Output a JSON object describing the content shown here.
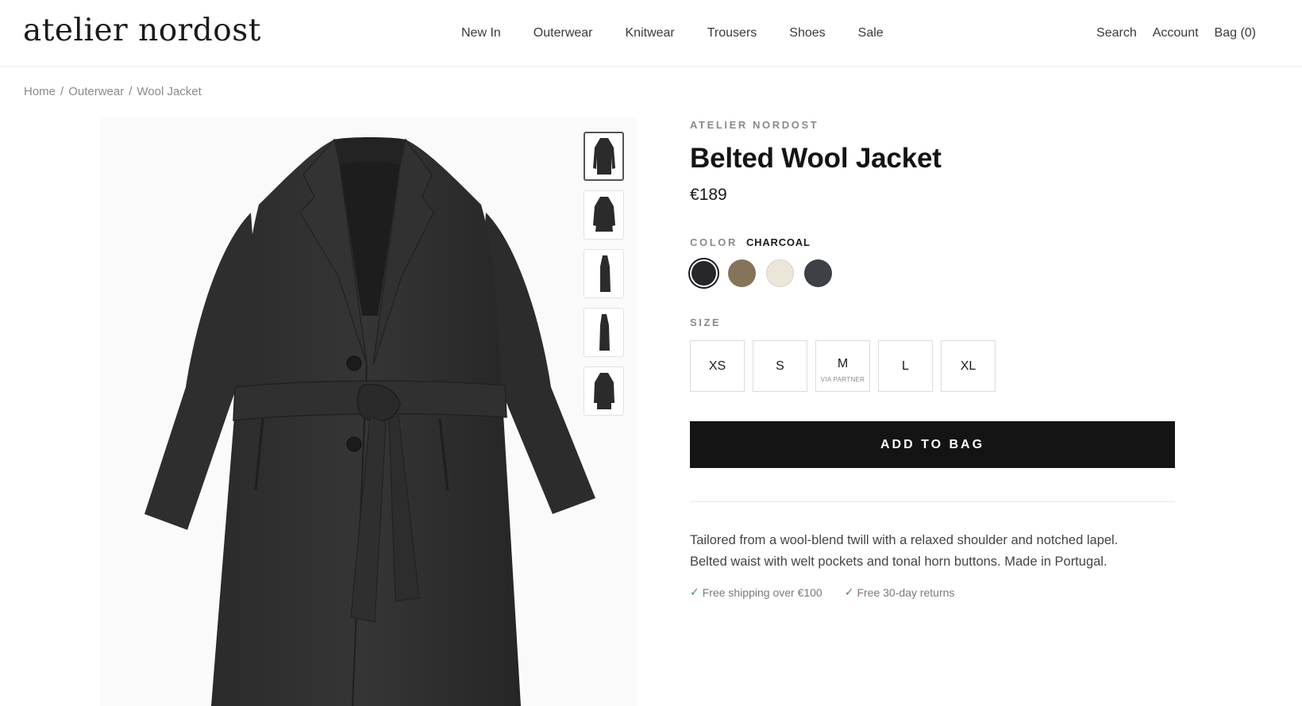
{
  "header": {
    "logo": "atelier nordost",
    "nav": [
      "New In",
      "Outerwear",
      "Knitwear",
      "Trousers",
      "Shoes",
      "Sale"
    ],
    "search": "Search",
    "account": "Account",
    "bag": "Bag (0)"
  },
  "breadcrumb": {
    "home": "Home",
    "separator": "/",
    "category": "Outerwear",
    "current": "Wool Jacket"
  },
  "gallery": {
    "main_image": "charcoal-wool-coat",
    "thumbnails": [
      "front-view",
      "front-belted",
      "side-view",
      "side-back",
      "back-view"
    ],
    "active_thumbnail": 0
  },
  "product": {
    "brand": "ATELIER NORDOST",
    "title": "Belted Wool Jacket",
    "price": "€189",
    "color_label": "COLOR",
    "color_value": "CHARCOAL",
    "colors": [
      "#25272b",
      "#85745a",
      "#ebe6da",
      "#3d4045"
    ],
    "selected_color": 0,
    "size_label": "SIZE",
    "sizes": [
      {
        "label": "XS",
        "note": ""
      },
      {
        "label": "S",
        "note": ""
      },
      {
        "label": "M",
        "note": "VIA PARTNER"
      },
      {
        "label": "L",
        "note": ""
      },
      {
        "label": "XL",
        "note": ""
      }
    ],
    "add_to_bag": "ADD TO BAG",
    "description": "Tailored from a wool-blend twill with a relaxed shoulder and notched lapel. Belted waist with welt pockets and tonal horn buttons. Made in Portugal.",
    "perks": [
      "Free shipping over €100",
      "Free 30-day returns"
    ],
    "check_glyph": "✓"
  }
}
